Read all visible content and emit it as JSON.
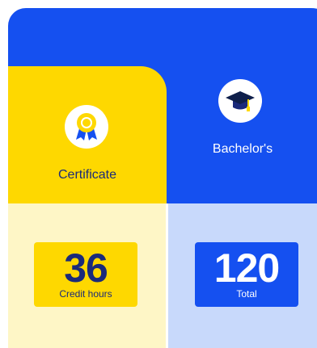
{
  "columns": [
    {
      "id": "certificate",
      "label": "Certificate",
      "icon": "award-ribbon-icon",
      "stat_value": "36",
      "stat_caption": "Credit hours",
      "accent_color": "#fed800",
      "light_color": "#fef6c6",
      "text_color": "#1a2a7a"
    },
    {
      "id": "bachelors",
      "label": "Bachelor's",
      "icon": "graduation-cap-icon",
      "stat_value": "120",
      "stat_caption": "Total",
      "accent_color": "#1550f0",
      "light_color": "#c8d9fb",
      "text_color": "#ffffff"
    }
  ]
}
